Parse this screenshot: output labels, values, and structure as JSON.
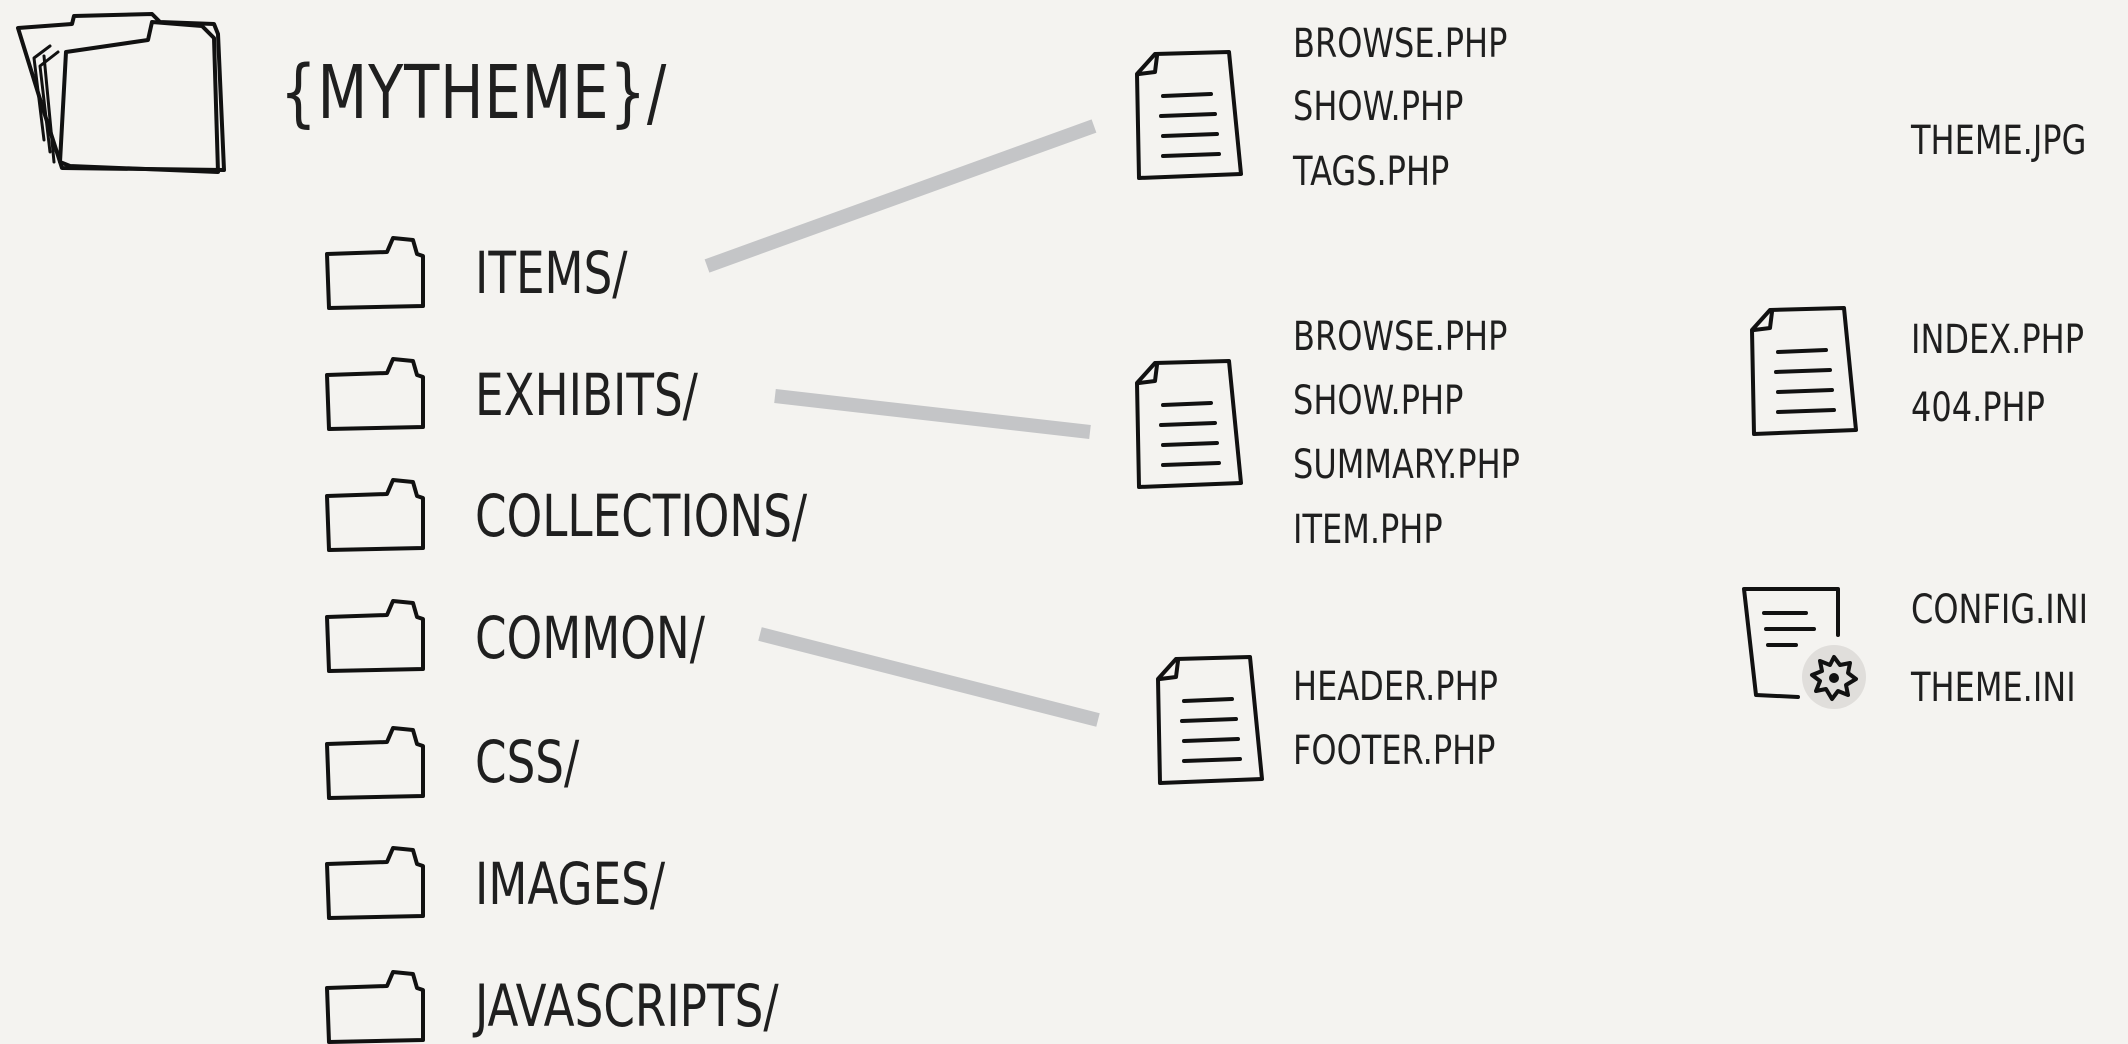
{
  "root": {
    "label": "{MYTHEME}/"
  },
  "folders": [
    {
      "label": "ITEMS/"
    },
    {
      "label": "EXHIBITS/"
    },
    {
      "label": "COLLECTIONS/"
    },
    {
      "label": "COMMON/"
    },
    {
      "label": "CSS/"
    },
    {
      "label": "IMAGES/"
    },
    {
      "label": "JAVASCRIPTS/"
    }
  ],
  "items_files": [
    "BROWSE.PHP",
    "SHOW.PHP",
    "TAGS.PHP"
  ],
  "exhibits_files": [
    "BROWSE.PHP",
    "SHOW.PHP",
    "SUMMARY.PHP",
    "ITEM.PHP"
  ],
  "common_files": [
    "HEADER.PHP",
    "FOOTER.PHP"
  ],
  "root_files": {
    "theme_image": "THEME.JPG",
    "php": [
      "INDEX.PHP",
      "404.PHP"
    ],
    "ini": [
      "CONFIG.INI",
      "THEME.INI"
    ]
  },
  "colors": {
    "background": "#f4f3f0",
    "ink": "#1f1f1f",
    "connector": "#c4c5c7"
  }
}
